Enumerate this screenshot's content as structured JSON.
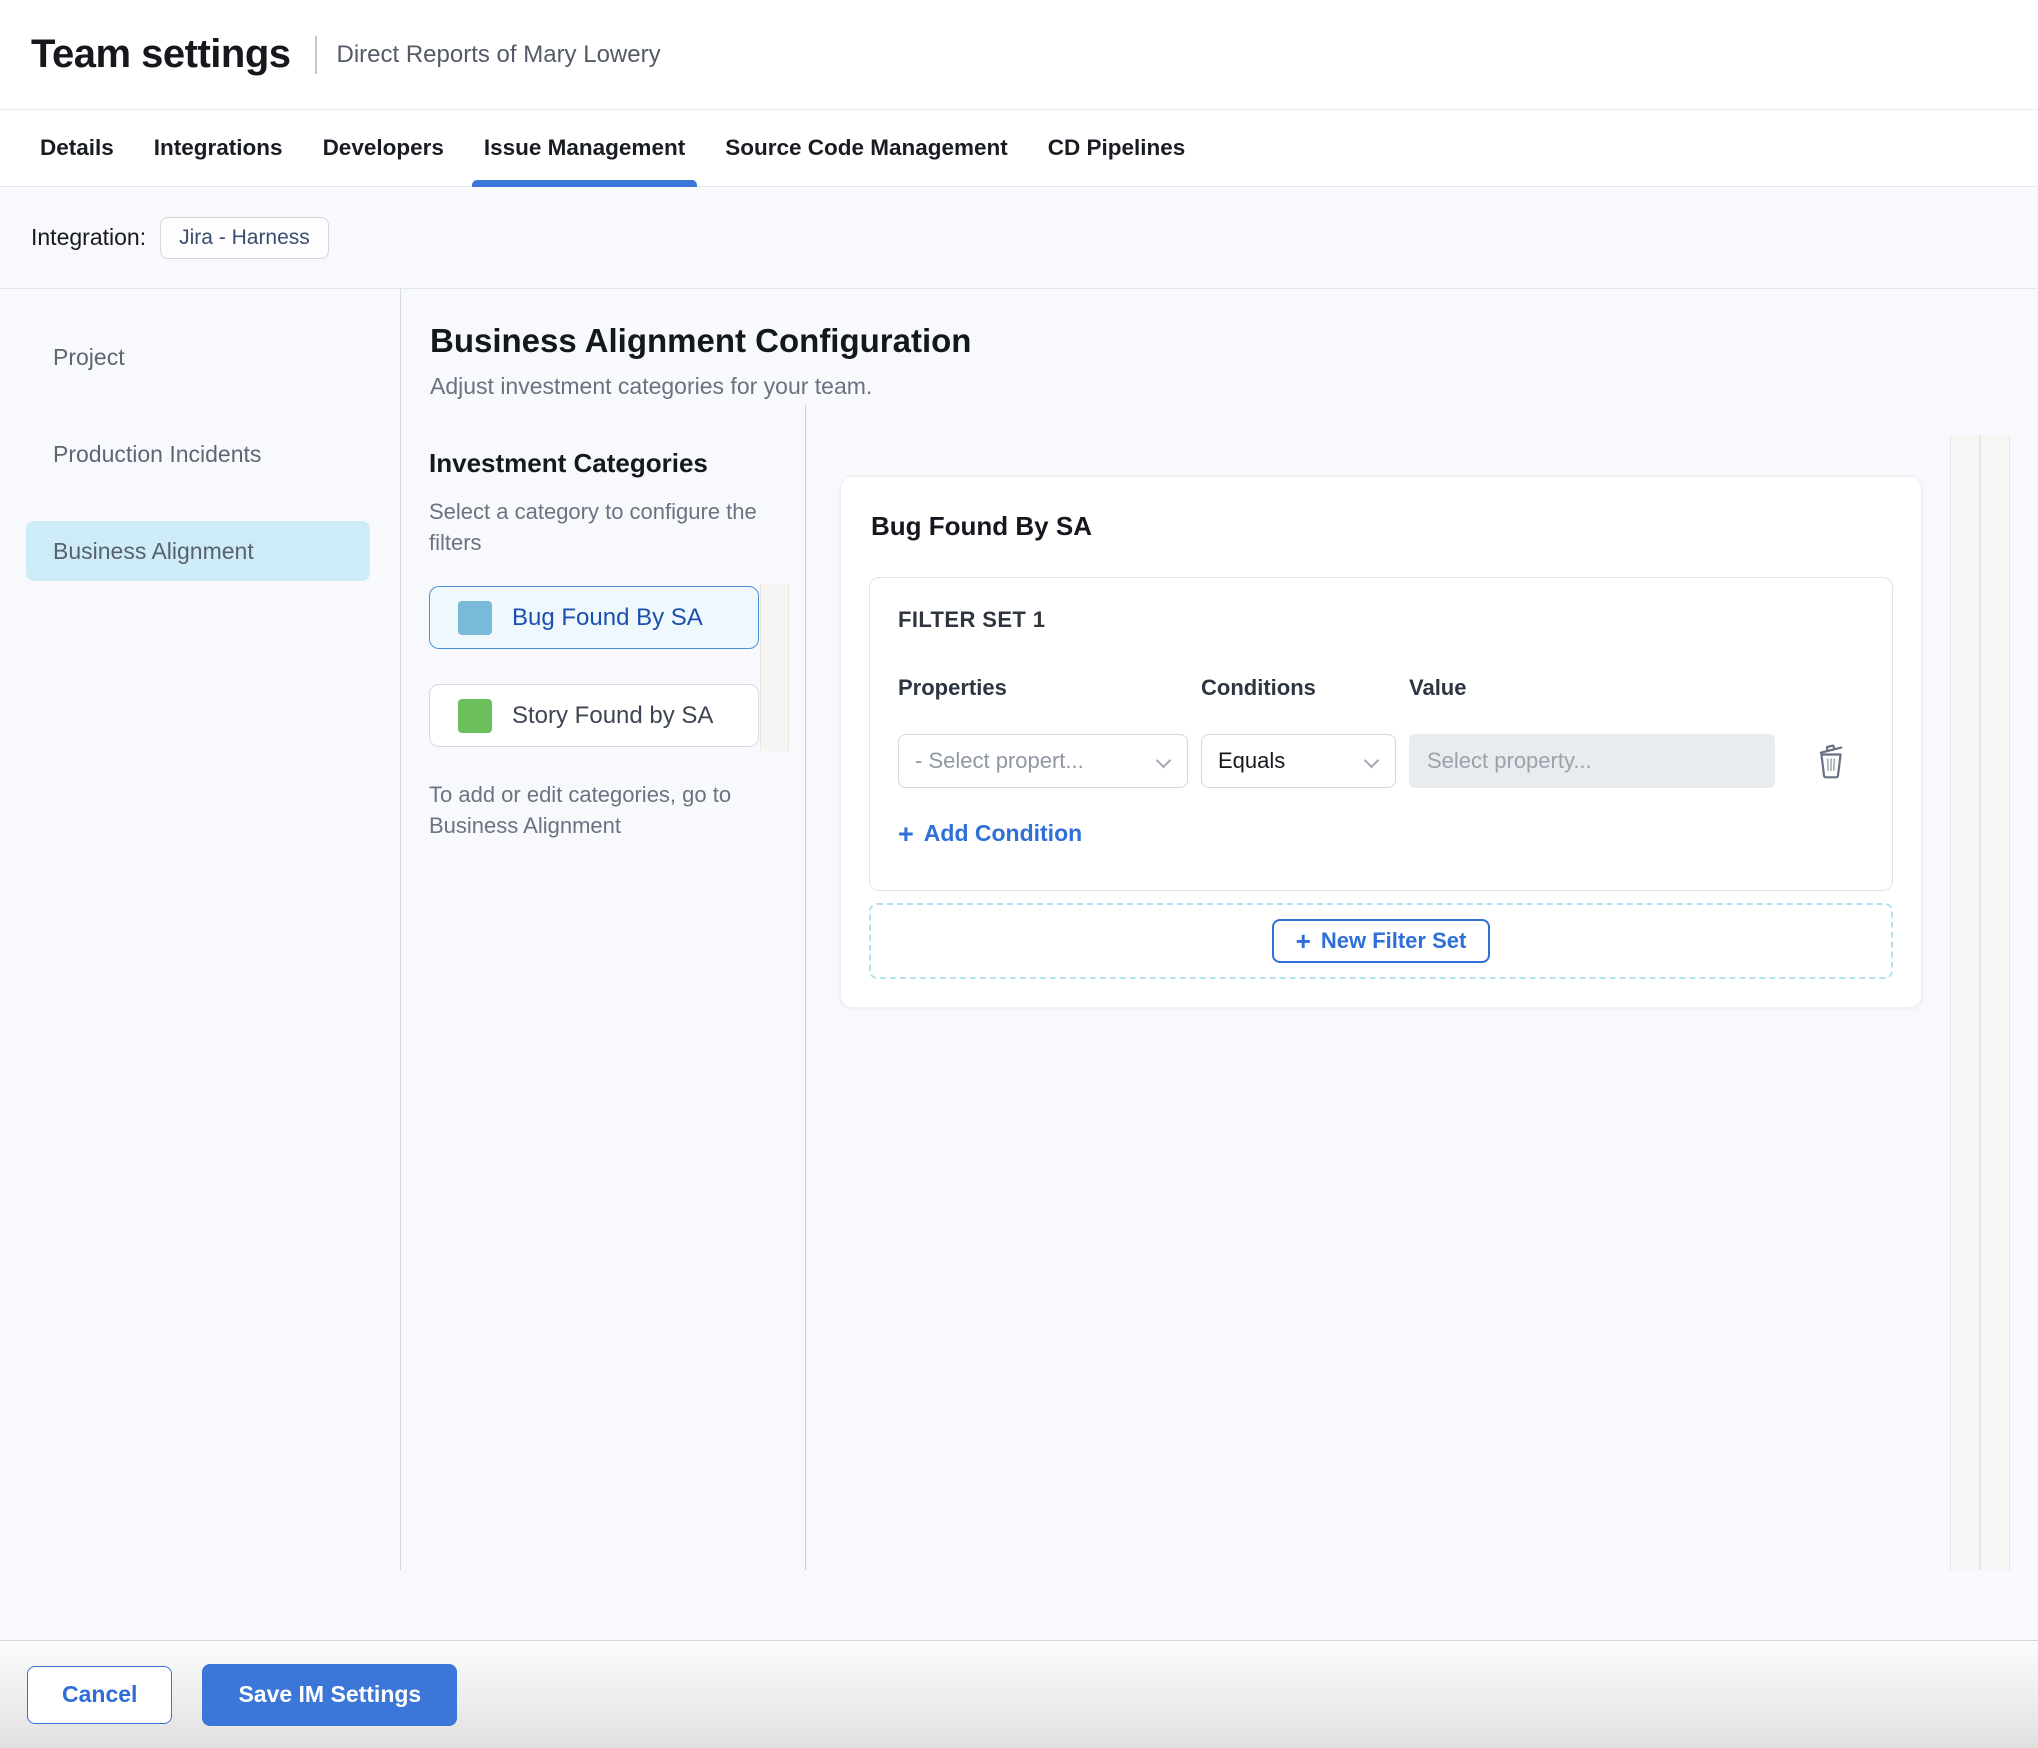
{
  "header": {
    "title": "Team settings",
    "subtitle": "Direct Reports of Mary Lowery"
  },
  "tabs": [
    {
      "label": "Details",
      "active": false
    },
    {
      "label": "Integrations",
      "active": false
    },
    {
      "label": "Developers",
      "active": false
    },
    {
      "label": "Issue Management",
      "active": true
    },
    {
      "label": "Source Code Management",
      "active": false
    },
    {
      "label": "CD Pipelines",
      "active": false
    }
  ],
  "integration": {
    "label": "Integration:",
    "chip": "Jira - Harness"
  },
  "sidebar": {
    "items": [
      {
        "label": "Project",
        "selected": false
      },
      {
        "label": "Production Incidents",
        "selected": false
      },
      {
        "label": "Business Alignment",
        "selected": true
      }
    ]
  },
  "main": {
    "title": "Business Alignment Configuration",
    "subtitle": "Adjust investment categories for your team."
  },
  "categories": {
    "heading": "Investment Categories",
    "hint": "Select a category to configure the filters",
    "items": [
      {
        "label": "Bug Found By SA",
        "color": "#79bad9",
        "selected": true
      },
      {
        "label": "Story Found by SA",
        "color": "#6cc05c",
        "selected": false
      }
    ],
    "footnote": "To add or edit categories, go to Business Alignment"
  },
  "panel": {
    "title": "Bug Found By SA",
    "filter_set": {
      "label": "FILTER SET 1",
      "columns": [
        "Properties",
        "Conditions",
        "Value"
      ],
      "property_select": "- Select propert...",
      "condition_select": "Equals",
      "value_placeholder": "Select property...",
      "add_condition": "Add Condition"
    },
    "new_filter_set": "New Filter Set"
  },
  "footer": {
    "cancel": "Cancel",
    "save": "Save IM Settings"
  },
  "icons": {
    "plus": "+"
  },
  "colors": {
    "accent-blue": "#3b76d8",
    "link-blue": "#2e6fd8",
    "page-bg": "#f8f9fc",
    "sidebar-sel": "#cdecf8",
    "cat-sel-bg": "#eef8fd",
    "cat-sel-border": "#4e90d5",
    "cat-sel-text": "#1d4fae"
  }
}
